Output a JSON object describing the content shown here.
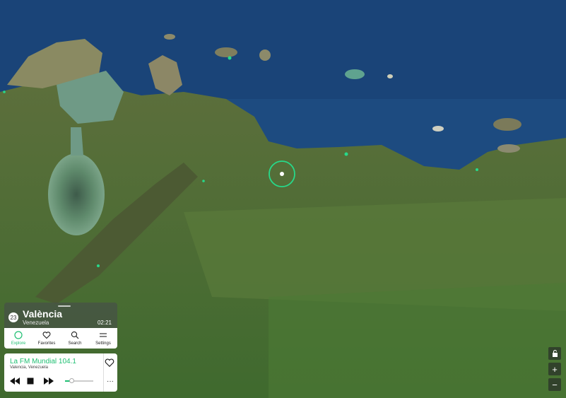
{
  "city": {
    "count": "23",
    "name": "València",
    "country": "Venezuela",
    "local_time": "02:21"
  },
  "nav": [
    {
      "label": "Explore",
      "icon": "explore-icon",
      "active": true
    },
    {
      "label": "Favorites",
      "icon": "heart-icon",
      "active": false
    },
    {
      "label": "Search",
      "icon": "search-icon",
      "active": false
    },
    {
      "label": "Settings",
      "icon": "settings-icon",
      "active": false
    }
  ],
  "player": {
    "station": "La FM Mundial 104.1",
    "location": "Valencia, Venezuela",
    "volume_fraction": 0.22,
    "more_label": "···"
  },
  "map_controls": {
    "zoom_in": "+",
    "zoom_out": "−"
  },
  "colors": {
    "accent": "#1fbf72",
    "sea": "#1e4f86",
    "land": "#4a6b34"
  }
}
